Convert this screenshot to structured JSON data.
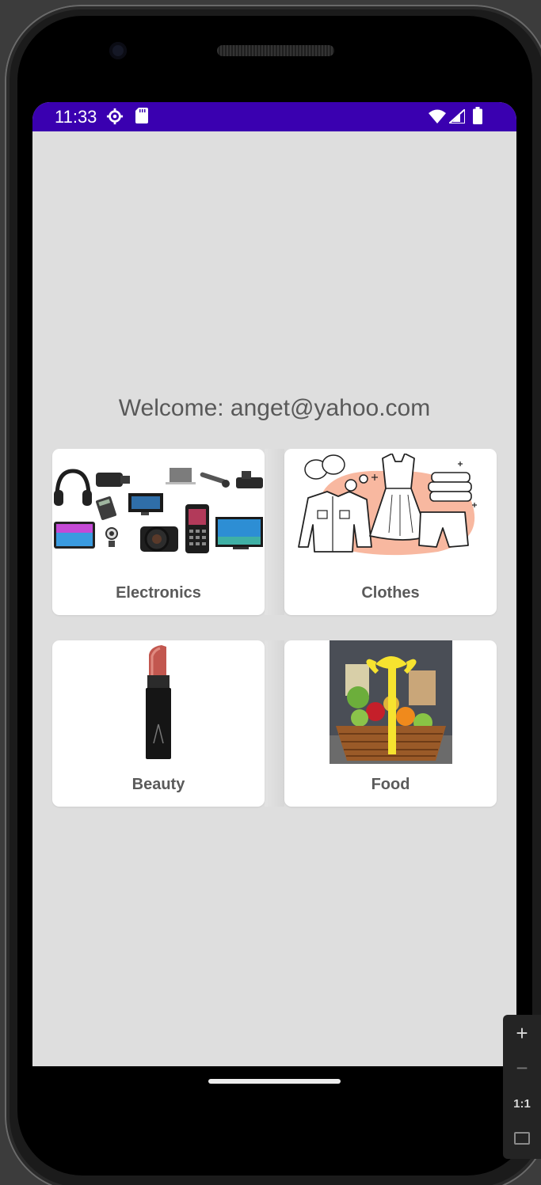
{
  "status_bar": {
    "time": "11:33",
    "icons": [
      "settings-gear-icon",
      "sd-card-icon",
      "wifi-icon",
      "signal-icon",
      "battery-icon"
    ]
  },
  "welcome_text": "Welcome: anget@yahoo.com",
  "categories": [
    {
      "label": "Electronics",
      "image": "electronics-collage"
    },
    {
      "label": "Clothes",
      "image": "clothes-illustration"
    },
    {
      "label": "Beauty",
      "image": "lipstick"
    },
    {
      "label": "Food",
      "image": "fruit-basket"
    }
  ],
  "emulator_controls": {
    "zoom_in": "+",
    "zoom_out": "−",
    "actual_size": "1:1"
  },
  "colors": {
    "status_bar": "#3a00b0",
    "screen_bg": "#dedede",
    "card_bg": "#ffffff",
    "label": "#5a5a5a"
  }
}
